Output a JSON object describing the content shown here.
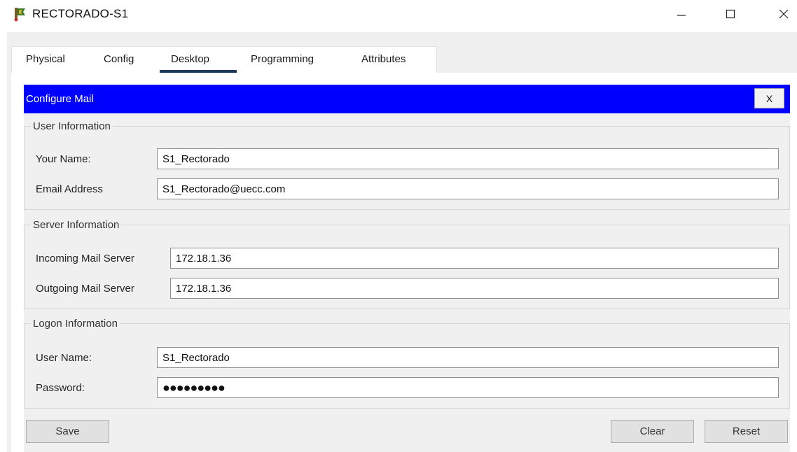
{
  "window": {
    "title": "RECTORADO-S1",
    "controls": {
      "minimize": "minimize-icon",
      "maximize": "maximize-icon",
      "close": "close-icon"
    }
  },
  "tabs": [
    {
      "label": "Physical"
    },
    {
      "label": "Config"
    },
    {
      "label": "Desktop",
      "selected": true
    },
    {
      "label": "Programming"
    },
    {
      "label": "Attributes"
    }
  ],
  "dialog": {
    "title": "Configure Mail",
    "close_label": "X",
    "header_color": "#0000ff"
  },
  "user_info": {
    "legend": "User Information",
    "name_label": "Your Name:",
    "name_value": "S1_Rectorado",
    "email_label": "Email Address",
    "email_value": "S1_Rectorado@uecc.com"
  },
  "server_info": {
    "legend": "Server Information",
    "incoming_label": "Incoming Mail Server",
    "incoming_value": "172.18.1.36",
    "outgoing_label": "Outgoing Mail Server",
    "outgoing_value": "172.18.1.36"
  },
  "logon_info": {
    "legend": "Logon Information",
    "username_label": "User Name:",
    "username_value": "S1_Rectorado",
    "password_label": "Password:",
    "password_value": "●●●●●●●●●"
  },
  "buttons": {
    "save": "Save",
    "clear": "Clear",
    "reset": "Reset"
  }
}
